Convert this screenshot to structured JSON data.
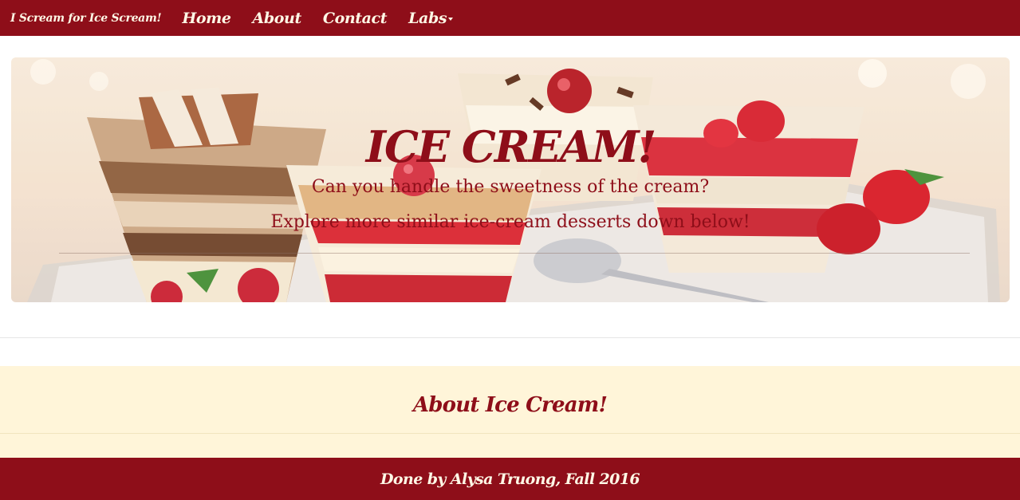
{
  "navbar": {
    "brand": "I Scream for Ice Scream!",
    "links": [
      {
        "label": "Home"
      },
      {
        "label": "About"
      },
      {
        "label": "Contact"
      },
      {
        "label": "Labs"
      }
    ]
  },
  "hero": {
    "title": "ICE CREAM!",
    "line1": "Can you handle the sweetness of the cream?",
    "line2": "Explore more similar ice-cream desserts down below!"
  },
  "about": {
    "title": "About Ice Cream!"
  },
  "footer": {
    "text": "Done by Alysa Truong, Fall 2016"
  },
  "colors": {
    "brand": "#8e0e19",
    "nav_text": "#fff8e6",
    "about_bg": "#fff5d9"
  }
}
